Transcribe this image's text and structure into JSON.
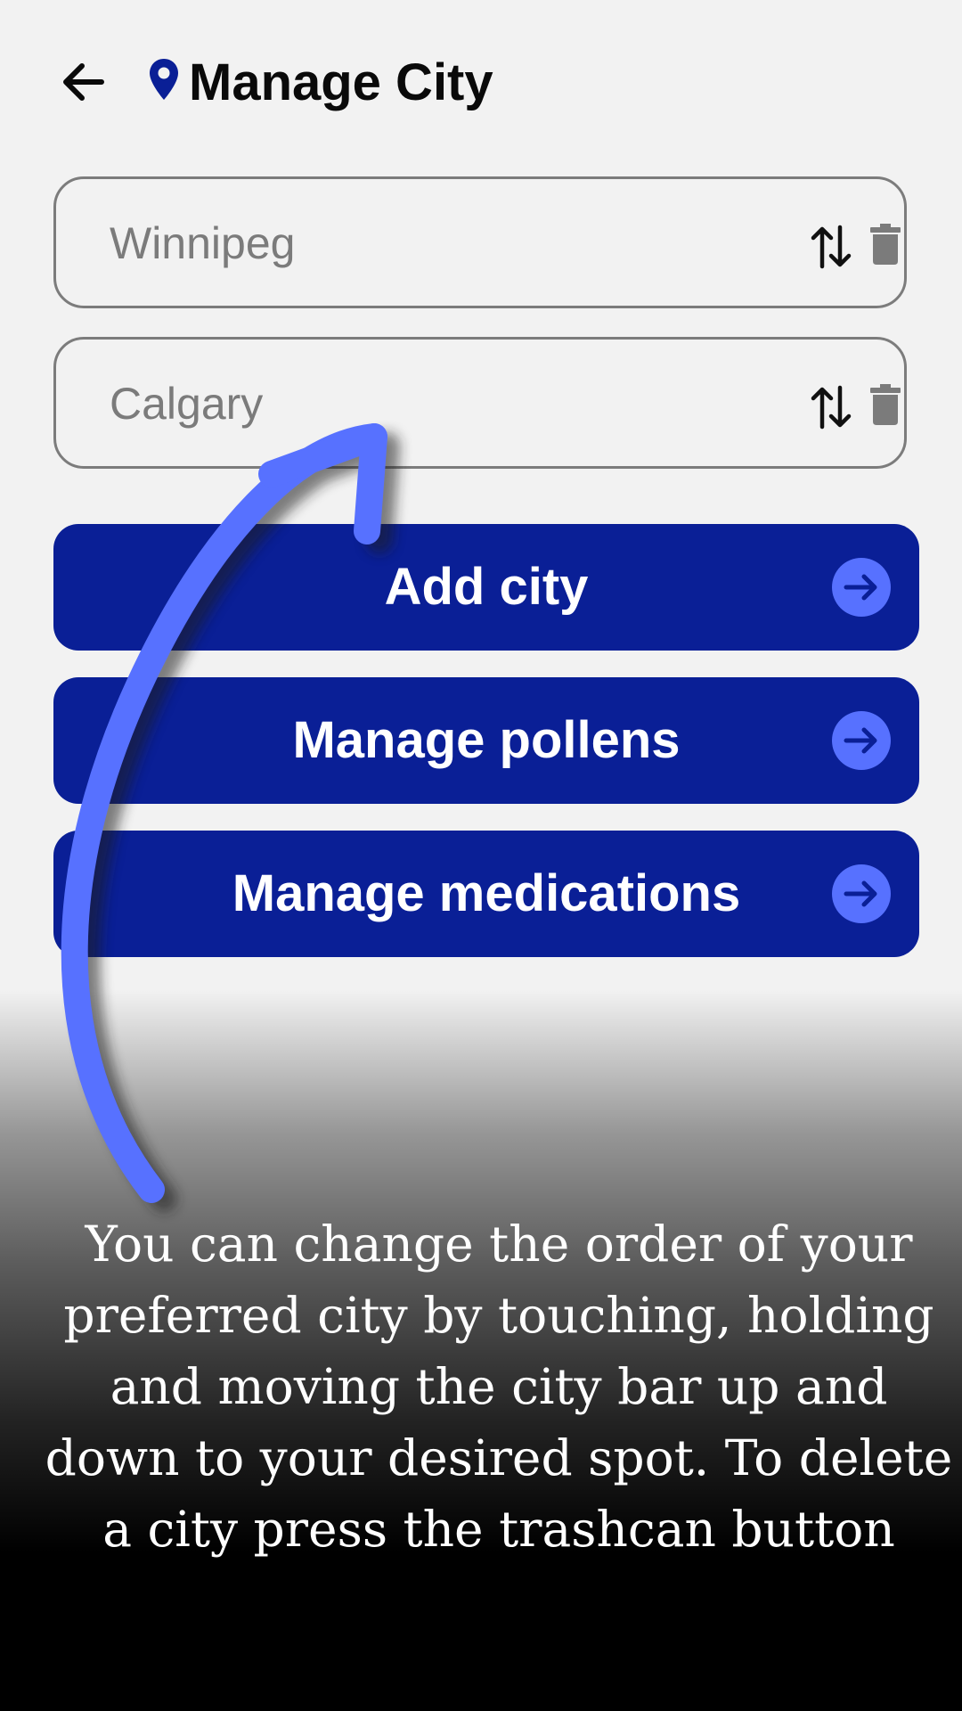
{
  "header": {
    "title": "Manage City",
    "back_icon": "back-arrow-icon",
    "title_icon": "location-pin-icon"
  },
  "cities": [
    {
      "name": "Winnipeg",
      "reorder_icon": "swap-vertical-icon",
      "delete_icon": "trash-icon"
    },
    {
      "name": "Calgary",
      "reorder_icon": "swap-vertical-icon",
      "delete_icon": "trash-icon"
    }
  ],
  "buttons": {
    "add_city": "Add city",
    "manage_pollens": "Manage pollens",
    "manage_medications": "Manage medications"
  },
  "tutorial": {
    "text": "You can change the order of your preferred city by touching, holding and moving the city bar up and down to your desired spot. To delete a city press the trashcan button"
  },
  "colors": {
    "primary": "#0a1f96",
    "arrow_accent": "#5771ff",
    "background": "#f2f2f2",
    "field_text": "#7b7b7b"
  }
}
